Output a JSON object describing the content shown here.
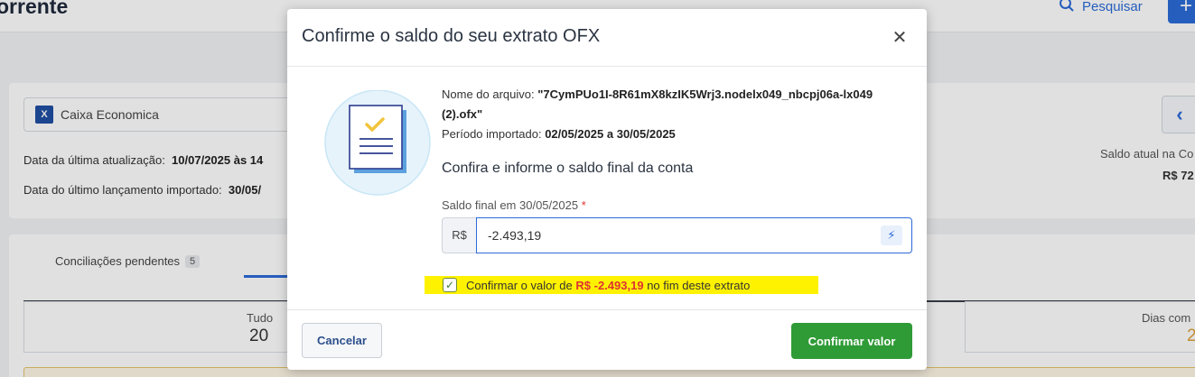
{
  "background": {
    "page_title": "orrente",
    "search_label": "Pesquisar",
    "add_label": "+",
    "bank_name": "Caixa Economica",
    "bank_logo_text": "X",
    "last_update_label": "Data da última atualização:",
    "last_update_value": "10/07/2025 às 14",
    "last_import_label": "Data do último lançamento importado:",
    "last_import_value": "30/05/",
    "saldo_label": "Saldo atual na Co",
    "saldo_value": "R$ 72",
    "tab_label": "Conciliações pendentes",
    "tab_count": "5",
    "stats": [
      {
        "label": "Tudo",
        "value": "20"
      },
      {
        "label": "Dias com",
        "value": "2"
      }
    ]
  },
  "modal": {
    "title": "Confirme o saldo do seu extrato OFX",
    "file_label": "Nome do arquivo:",
    "file_name": "\"7CymPUo1I-8R61mX8kzIK5Wrj3.nodelx049_nbcpj06a-lx049 (2).ofx\"",
    "period_label": "Período importado:",
    "period_value": "02/05/2025 a 30/05/2025",
    "subtitle": "Confira e informe o saldo final da conta",
    "field_label": "Saldo final em 30/05/2025",
    "required_mark": "*",
    "currency_prefix": "R$",
    "input_value": "-2.493,19",
    "confirm_text_before": "Confirmar o valor de",
    "confirm_amount": "R$ -2.493,19",
    "confirm_text_after": "no fim deste extrato",
    "cancel_label": "Cancelar",
    "confirm_label": "Confirmar valor"
  },
  "colors": {
    "primary": "#2c6bd8",
    "success": "#2f9b36",
    "negative": "#d33333",
    "highlight": "#fff200"
  }
}
